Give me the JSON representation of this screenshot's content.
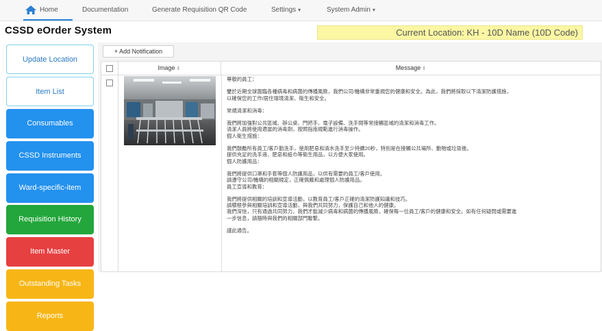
{
  "nav": {
    "home": "Home",
    "documentation": "Documentation",
    "generate_qr": "Generate Requisition QR Code",
    "settings": "Settings",
    "system_admin": "System Admin",
    "caret": "▾"
  },
  "app_title": "CSSD eOrder System",
  "current_location": "Current Location: KH - 10D Name (10D Code)",
  "sidebar": [
    {
      "label": "Update Location"
    },
    {
      "label": "Item List"
    },
    {
      "label": "Consumables"
    },
    {
      "label": "CSSD Instruments"
    },
    {
      "label": "Ward-specific-item"
    },
    {
      "label": "Requisition History"
    },
    {
      "label": "Item Master"
    },
    {
      "label": "Outstanding Tasks"
    },
    {
      "label": "Reports"
    }
  ],
  "toolbar": {
    "add_notification": "+ Add Notification"
  },
  "table": {
    "columns": {
      "image": "Image",
      "message": "Message",
      "sort_glyph": "⇕"
    },
    "rows": [
      {
        "message_lines": [
          "尊敬的員工：",
          "",
          "鑒於近期全球面臨各種病毒和病菌的傳播風險，我們公司/機構非常重視您的健康和安全。為此，我們將採取以下清潔防護措施，",
          "以確保您的工作/居住環境清潔、衛生和安全。",
          "",
          "常規清潔和消毒：",
          "",
          "我們將加強對公共區域、辦公桌、門把手、電子設備、洗手間等常接觸區域的清潔和消毒工作。",
          "清潔人員將使用適當的消毒劑，按照指南規範進行消毒操作。",
          "個人衛生措施：",
          "",
          "我們鼓勵所有員工/客戶勤洗手，使用肥皂和清水洗手至少持續20秒，特別是在接觸公共場所、動物或垃圾後。",
          "提供充足的洗手液、肥皂和紙巾等衛生用品，以方便大家使用。",
          "個人防護用品：",
          "",
          "我們將提供口罩和手套等個人防護用品，以供有需要的員工/客戶使用。",
          "請遵守公司/機構的相關規定，正確佩戴和處理個人防護用品。",
          "員工宣導和教育：",
          "",
          "我們將提供相關的培訓和宣導活動，以教育員工/客戶正確的清潔防護知識和技巧。",
          "請積極參與相關培訓和宣導活動，與我們共同努力，保護自己和他人的健康。",
          "我們深信，只有通過共同努力，我們才能減少病毒和病菌的傳播風險，確保每一位員工/客戶的健康和安全。如有任何疑問或需要進",
          "一步信息，請隨時與我們的相關部門聯繫。",
          "",
          "謹此通告。"
        ]
      }
    ]
  }
}
